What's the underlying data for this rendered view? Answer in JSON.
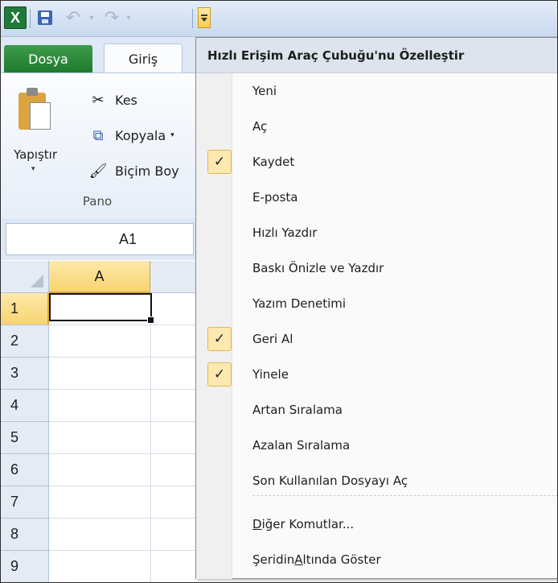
{
  "titlebar": {
    "app_icon": "X",
    "icons": [
      "excel-icon",
      "save-icon",
      "undo-icon",
      "redo-icon",
      "customize-qat-icon"
    ],
    "undo_glyph": "↶",
    "redo_glyph": "↷",
    "dropdown_glyph": "▾"
  },
  "tabs": {
    "file": "Dosya",
    "home": "Giriş"
  },
  "ribbon": {
    "paste": "Yapıştır",
    "paste_arrow": "▾",
    "cut": "Kes",
    "copy": "Kopyala",
    "copy_arrow": "▾",
    "format_painter": "Biçim Boy",
    "group": "Pano",
    "cut_glyph": "✂",
    "copy_glyph": "⧉",
    "brush_glyph": "🖌"
  },
  "namebox": {
    "value": "A1"
  },
  "grid": {
    "column": "A",
    "rows": [
      "1",
      "2",
      "3",
      "4",
      "5",
      "6",
      "7",
      "8",
      "9"
    ]
  },
  "menu": {
    "title": "Hızlı Erişim Araç Çubuğu'nu Özelleştir",
    "check_glyph": "✓",
    "items": [
      {
        "label": "Yeni",
        "checked": false
      },
      {
        "label": "Aç",
        "checked": false
      },
      {
        "label": "Kaydet",
        "checked": true
      },
      {
        "label": "E-posta",
        "checked": false
      },
      {
        "label": "Hızlı Yazdır",
        "checked": false
      },
      {
        "label": "Baskı Önizle ve Yazdır",
        "checked": false
      },
      {
        "label": "Yazım Denetimi",
        "checked": false
      },
      {
        "label": "Geri Al",
        "checked": true
      },
      {
        "label": "Yinele",
        "checked": true
      },
      {
        "label": "Artan Sıralama",
        "checked": false
      },
      {
        "label": "Azalan Sıralama",
        "checked": false
      },
      {
        "label": "Son Kullanılan Dosyayı Aç",
        "checked": false
      }
    ],
    "more_commands": {
      "pre": "",
      "u": "D",
      "mid": "iğer Komutlar..."
    },
    "show_below": {
      "pre": "Şeridin ",
      "u": "A",
      "mid": "ltında Göster"
    }
  }
}
